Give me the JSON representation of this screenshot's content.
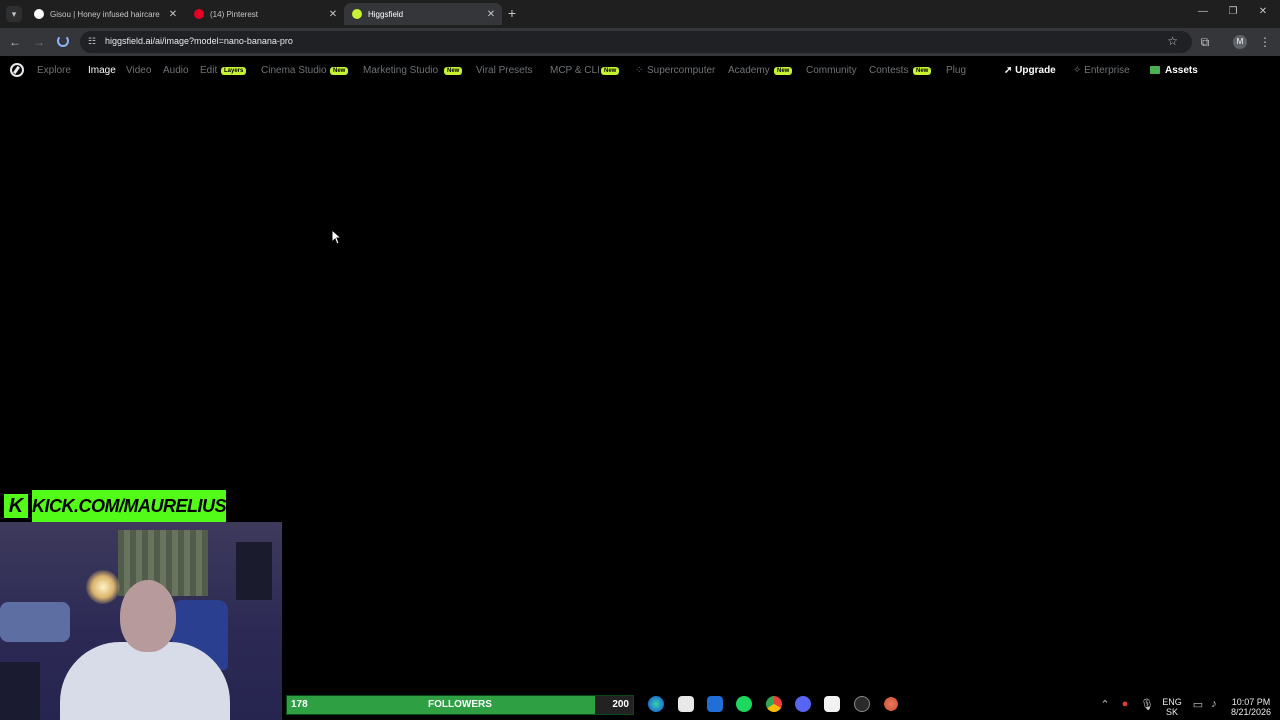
{
  "browser": {
    "tabs": [
      {
        "title": "Gisou | Honey infused haircare",
        "favicon_color": "#ffffff",
        "active": false
      },
      {
        "title": "(14) Pinterest",
        "favicon_color": "#e60023",
        "active": false
      },
      {
        "title": "Higgsfield",
        "favicon_color": "#c6f432",
        "active": true
      }
    ],
    "new_tab_label": "+",
    "window_controls": {
      "minimize": "—",
      "restore": "❐",
      "close": "✕"
    },
    "url": "higgsfield.ai/ai/image?model=nano-banana-pro",
    "profile_initial": "M"
  },
  "site_nav": {
    "items": [
      {
        "label": "Explore",
        "active": false
      },
      {
        "label": "Image",
        "active": true
      },
      {
        "label": "Video",
        "active": false
      },
      {
        "label": "Audio",
        "active": false
      },
      {
        "label": "Edit",
        "active": false,
        "badge": "Layers"
      },
      {
        "label": "Cinema Studio",
        "active": false,
        "badge": "New"
      },
      {
        "label": "Marketing Studio",
        "active": false,
        "badge": "New"
      },
      {
        "label": "Viral Presets",
        "active": false
      },
      {
        "label": "MCP & CLI",
        "active": false,
        "badge": "New"
      },
      {
        "label": "Supercomputer",
        "active": false
      },
      {
        "label": "Academy",
        "active": false,
        "badge": "New"
      },
      {
        "label": "Community",
        "active": false
      },
      {
        "label": "Contests",
        "active": false,
        "badge": "New"
      },
      {
        "label": "Plug",
        "active": false
      }
    ],
    "upgrade_label": "Upgrade",
    "enterprise_label": "Enterprise",
    "assets_label": "Assets",
    "accent_color": "#c6f432"
  },
  "overlay": {
    "kick_url": "KICK.COM/MAURELIUSS",
    "kick_logo": "K",
    "followers": {
      "current": "178",
      "label": "FOLLOWERS",
      "goal": "200",
      "progress": 0.89
    },
    "kick_color": "#53fc18"
  },
  "taskbar": {
    "language": "ENG",
    "language_sub": "SK",
    "time": "10:07 PM",
    "date": "8/21/2026"
  }
}
